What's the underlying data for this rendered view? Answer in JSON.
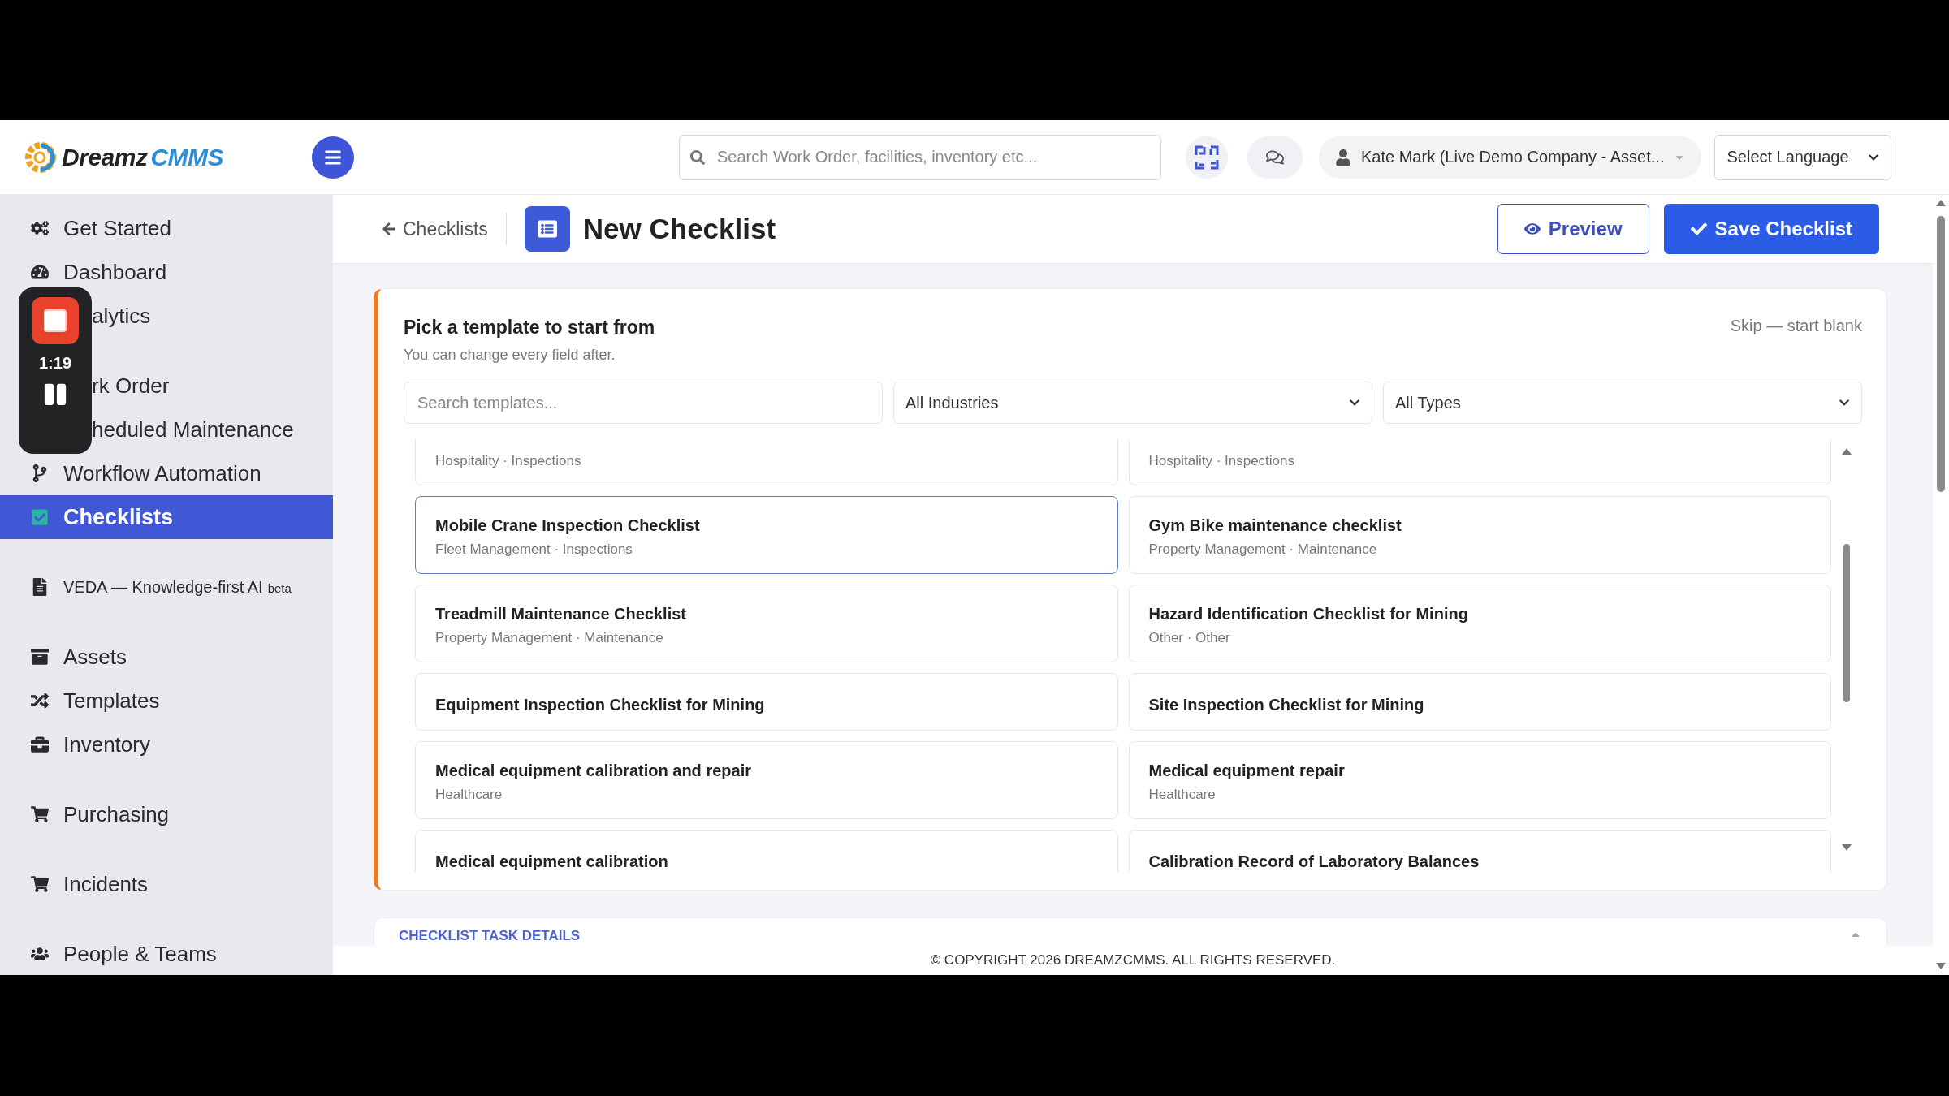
{
  "logo": {
    "part_1": "Dreamz",
    "part_2": "CMMS"
  },
  "topbar": {
    "search": {
      "placeholder": "Search Work Order, facilities, inventory etc..."
    },
    "user": "Kate Mark (Live Demo Company - Asset...",
    "language": "Select Language"
  },
  "sidebar": {
    "sections": [
      [
        {
          "label": "Get Started",
          "selected": false
        },
        {
          "label": "Dashboard",
          "selected": false
        },
        {
          "label": "alytics",
          "selected": false
        }
      ],
      [
        {
          "label": "rk Order",
          "selected": false
        },
        {
          "label": "heduled Maintenance",
          "selected": false
        },
        {
          "label": "Workflow Automation",
          "selected": false
        },
        {
          "label": "Checklists",
          "selected": true
        }
      ],
      [
        {
          "label": "VEDA — Knowledge-first AI",
          "badge": "beta",
          "selected": false
        }
      ],
      [
        {
          "label": "Assets",
          "selected": false
        },
        {
          "label": "Templates",
          "selected": false
        },
        {
          "label": "Inventory",
          "selected": false
        }
      ],
      [
        {
          "label": "Purchasing",
          "selected": false
        }
      ],
      [
        {
          "label": "Incidents",
          "selected": false
        }
      ],
      [
        {
          "label": "People & Teams",
          "selected": false
        }
      ]
    ]
  },
  "recorder": {
    "time": "1:19"
  },
  "page_header": {
    "back": "Checklists",
    "title": "New Checklist",
    "buttons": [
      "Preview",
      "Save Checklist"
    ]
  },
  "template_picker": {
    "title": "Pick a template to start from",
    "subtitle": "You can change every field after.",
    "skip": "Skip — start blank",
    "search": {
      "placeholder": "Search templates..."
    },
    "filters": [
      "All Industries",
      "All Types"
    ],
    "templates": [
      {
        "subtitle": "Hospitality · Inspections",
        "selected": false
      },
      {
        "subtitle": "Hospitality · Inspections",
        "selected": false
      },
      {
        "title": "Mobile Crane Inspection Checklist",
        "subtitle": "Fleet Management · Inspections",
        "selected": true
      },
      {
        "title": "Gym Bike maintenance checklist",
        "subtitle": "Property Management · Maintenance",
        "selected": false
      },
      {
        "title": "Treadmill Maintenance Checklist",
        "subtitle": "Property Management · Maintenance",
        "selected": false
      },
      {
        "title": "Hazard Identification Checklist for Mining",
        "subtitle": "Other · Other",
        "selected": false
      },
      {
        "title": "Equipment Inspection Checklist for Mining",
        "selected": false
      },
      {
        "title": "Site Inspection Checklist for Mining",
        "selected": false
      },
      {
        "title": "Medical equipment calibration and repair",
        "subtitle": "Healthcare",
        "selected": false
      },
      {
        "title": "Medical equipment repair",
        "subtitle": "Healthcare",
        "selected": false
      },
      {
        "title": "Medical equipment calibration",
        "selected": false
      },
      {
        "title": "Calibration Record of Laboratory Balances",
        "selected": false
      }
    ]
  },
  "next_section": {
    "title": "CHECKLIST TASK DETAILS"
  },
  "footer": "© COPYRIGHT 2026 DREAMZCMMS. ALL RIGHTS RESERVED."
}
